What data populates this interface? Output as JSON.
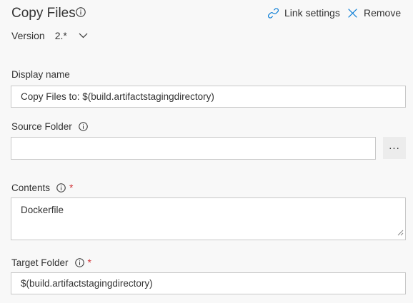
{
  "header": {
    "title": "Copy Files",
    "link_settings_label": "Link settings",
    "remove_label": "Remove"
  },
  "version": {
    "label": "Version",
    "value": "2.*"
  },
  "fields": {
    "display_name": {
      "label": "Display name",
      "value": "Copy Files to: $(build.artifactstagingdirectory)"
    },
    "source_folder": {
      "label": "Source Folder",
      "value": "",
      "browse_label": "..."
    },
    "contents": {
      "label": "Contents",
      "required_mark": "*",
      "value": "Dockerfile"
    },
    "target_folder": {
      "label": "Target Folder",
      "required_mark": "*",
      "value": "$(build.artifactstagingdirectory)"
    }
  },
  "colors": {
    "accent": "#0078d4",
    "required": "#d13438",
    "text": "#333333",
    "border": "#c8c8c8",
    "background": "#f8f8f8"
  },
  "icons": {
    "title_info": "info-icon",
    "link": "link-icon",
    "remove": "close-icon",
    "version_dropdown": "chevron-down-icon",
    "field_info": "info-icon",
    "resize": "resize-handle-icon"
  }
}
